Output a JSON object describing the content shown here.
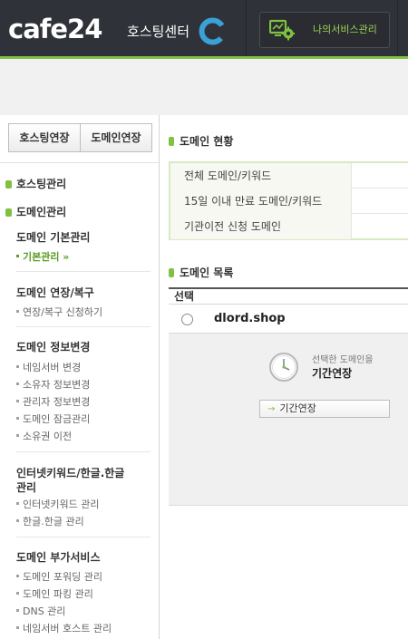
{
  "header": {
    "logo_text": "cafe24",
    "logo_sub": "호스팅센터",
    "my_service_label": "나의서비스관리",
    "accent_color": "#7fc241"
  },
  "sidebar": {
    "tabs": [
      "호스팅연장",
      "도메인연장"
    ],
    "categories": [
      {
        "label": "호스팅관리"
      },
      {
        "label": "도메인관리"
      }
    ],
    "groups": [
      {
        "title": "도메인 기본관리",
        "items": [
          "기본관리 »"
        ],
        "active_item": 0
      },
      {
        "title": "도메인 연장/복구",
        "items": [
          "연장/복구 신청하기"
        ]
      },
      {
        "title": "도메인 정보변경",
        "items": [
          "네임서버 변경",
          "소유자 정보변경",
          "관리자 정보변경",
          "도메인 잠금관리",
          "소유권 이전"
        ]
      },
      {
        "title_line1": "인터넷키워드/한글.한글",
        "title_line2": "관리",
        "items": [
          "인터넷키워드 관리",
          "한글.한글 관리"
        ]
      },
      {
        "title": "도메인 부가서비스",
        "items": [
          "도메인 포워딩 관리",
          "도메인 파킹 관리",
          "DNS 관리",
          "네임서버 호스트 관리"
        ]
      }
    ]
  },
  "main": {
    "status_title": "도메인 현황",
    "status_rows": [
      "전체 도메인/키워드",
      "15일 이내 만료 도메인/키워드",
      "기관이전 신청 도메인"
    ],
    "list_title": "도메인 목록",
    "list_header": "선택",
    "domains": [
      {
        "name": "dlord.shop",
        "selected": false
      }
    ],
    "detail": {
      "sub_text": "선택한 도메인을",
      "main_text": "기간연장",
      "button_label": "기간연장",
      "button_arrow": "→"
    }
  }
}
